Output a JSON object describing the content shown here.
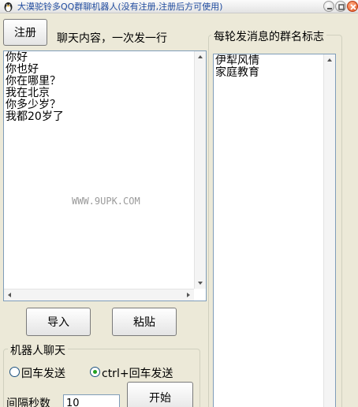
{
  "window": {
    "title": "大漠驼铃多QQ群聊机器人(没有注册,注册后方可使用)"
  },
  "left": {
    "register_label": "注册",
    "chat_heading": "聊天内容，一次发一行",
    "chat_lines": "你好\n你也好\n你在哪里？\n我在北京\n你多少岁？\n我都20岁了",
    "watermark": "WWW.9UPK.COM",
    "import_label": "导入",
    "paste_label": "粘贴"
  },
  "robot": {
    "group_title": "机器人聊天",
    "radio_enter": "回车发送",
    "radio_ctrl_enter": "ctrl+回车发送",
    "selected": "ctrl+回车发送",
    "interval_label": "间隔秒数",
    "interval_value": "10",
    "start_label": "开始"
  },
  "right": {
    "heading": "每轮发消息的群名标志",
    "group_lines": "伊犁风情\n家庭教育"
  }
}
